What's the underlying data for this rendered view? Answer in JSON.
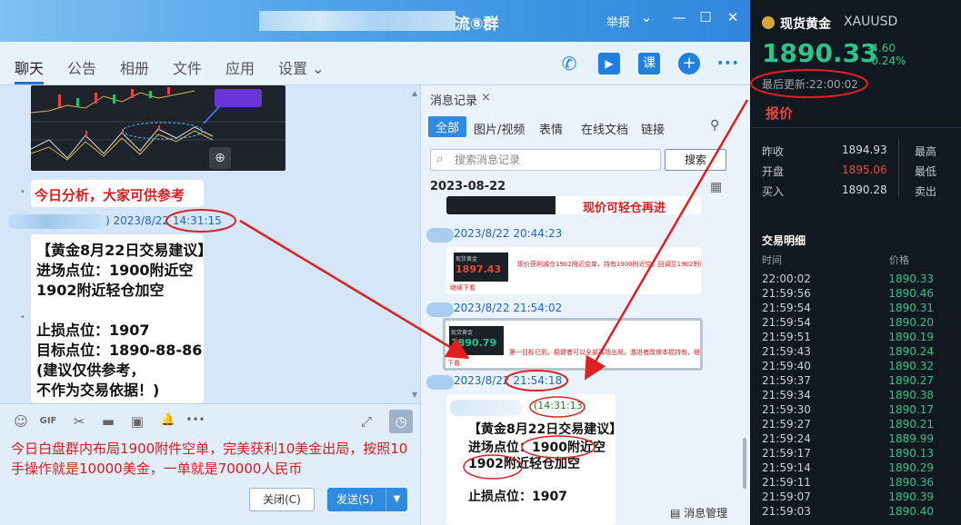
{
  "window": {
    "title_suffix": "流⑧群",
    "report": "举报",
    "chevron": "⌄",
    "minimize": "—",
    "maximize": "☐",
    "close": "✕"
  },
  "tabs": [
    "聊天",
    "公告",
    "相册",
    "文件",
    "应用",
    "设置 ⌄"
  ],
  "header_icons": {
    "call": "✆",
    "video": "▶",
    "course": "课",
    "add": "+",
    "more": "•••"
  },
  "chat": {
    "analysis_text": "今日分析，大家可供参考",
    "sender_time": ") 2023/8/22 14:31:15",
    "advice_lines": [
      "【黄金8月22日交易建议】",
      "进场点位：1900附近空",
      "1902附近轻仓加空",
      "止损点位：1907",
      "目标点位：1890-88-86",
      "(建议仅供参考，",
      "不作为交易依据！)"
    ]
  },
  "input": {
    "text": "今日白盘群内布局1900附件空单，完美获利10美金出局，按照10手操作就是10000美金，一单就是70000人民币",
    "close_label": "关闭(C)",
    "send_label": "发送(S)",
    "tools": {
      "emoji": "☺",
      "gif": "GIF",
      "scissors": "✂",
      "folder": "▬",
      "image": "▣",
      "bell": "🔔",
      "more": "•••",
      "expand": "⤢",
      "clock": "◷"
    }
  },
  "history": {
    "tab_label": "消息记录",
    "tab_close": "×",
    "filters": [
      "全部",
      "图片/视频",
      "表情",
      "在线文档",
      "链接"
    ],
    "search_placeholder": "搜索消息记录",
    "search_button": "搜索",
    "date": "2023-08-22",
    "top_snippet": "现价可轻仓再进",
    "msgs": [
      {
        "time": "2023/8/22 20:44:23",
        "mini_price": "1897.43",
        "note": "现价获利减仓1902附近空单，持有1900附近空，回调至1902附近。",
        "note2": "继续下看"
      },
      {
        "time": "2023/8/22 21:54:02",
        "mini_price": "1890.79",
        "note": "第一目标已到，稳健者可以全部离场出局，激进者改保本损持有，继续",
        "note2": "下看"
      },
      {
        "time": "2023/8/22 21:54:18"
      }
    ],
    "card_time": "(14:31:13",
    "card_lines": [
      "【黄金8月22日交易建议】",
      "进场点位：1900附近空",
      "1902附近轻仓加空",
      "止损点位：1907"
    ],
    "manage": "消息管理"
  },
  "quote": {
    "name": "现货黄金",
    "symbol": "XAUUSD",
    "price": "1890.33",
    "change": "-4.60",
    "change_pct": "-0.24%",
    "update": "最后更新:22:00:02",
    "section": "报价",
    "left_rows": [
      {
        "label": "昨收",
        "value": "1894.93",
        "color": "#d7dde4"
      },
      {
        "label": "开盘",
        "value": "1895.06",
        "color": "#e8493a"
      },
      {
        "label": "买入",
        "value": "1890.28",
        "color": "#d7dde4"
      }
    ],
    "right_labels": [
      "最高",
      "最低",
      "卖出"
    ],
    "detail_title": "交易明细",
    "col_time": "时间",
    "col_price": "价格",
    "trades": [
      {
        "time": "22:00:02",
        "price": "1890.33"
      },
      {
        "time": "21:59:56",
        "price": "1890.46"
      },
      {
        "time": "21:59:54",
        "price": "1890.31"
      },
      {
        "time": "21:59:54",
        "price": "1890.20"
      },
      {
        "time": "21:59:51",
        "price": "1890.19"
      },
      {
        "time": "21:59:43",
        "price": "1890.24"
      },
      {
        "time": "21:59:40",
        "price": "1890.32"
      },
      {
        "time": "21:59:37",
        "price": "1890.27"
      },
      {
        "time": "21:59:34",
        "price": "1890.38"
      },
      {
        "time": "21:59:30",
        "price": "1890.17"
      },
      {
        "time": "21:59:27",
        "price": "1890.21"
      },
      {
        "time": "21:59:24",
        "price": "1889.99"
      },
      {
        "time": "21:59:17",
        "price": "1890.13"
      },
      {
        "time": "21:59:14",
        "price": "1890.29"
      },
      {
        "time": "21:59:11",
        "price": "1890.36"
      },
      {
        "time": "21:59:07",
        "price": "1890.39"
      },
      {
        "time": "21:59:03",
        "price": "1890.40"
      }
    ]
  },
  "colors": {
    "red": "#e01c1c",
    "green": "#2bc48a",
    "blue": "#2f8be0"
  }
}
